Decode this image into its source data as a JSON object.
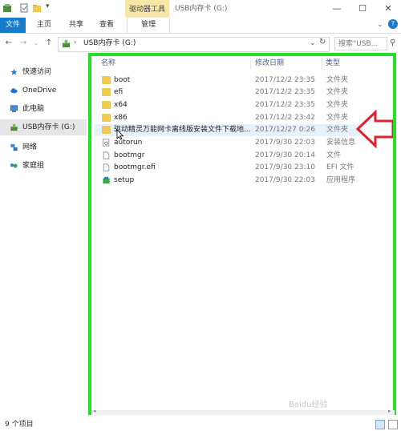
{
  "window": {
    "title": "USB内存卡 (G:)",
    "context_tab": "驱动器工具",
    "controls": {
      "minimize": "—",
      "maximize": "☐",
      "close": "✕"
    }
  },
  "ribbon": {
    "tabs": [
      "文件",
      "主页",
      "共享",
      "查看"
    ],
    "manage_tab": "管理"
  },
  "address": {
    "path": "USB内存卡 (G:)",
    "search_placeholder": "搜索\"USB...",
    "back": "←",
    "forward": "→",
    "up": "↑",
    "dropdown": "⌄",
    "refresh": "↻"
  },
  "nav_pane": {
    "items": [
      {
        "label": "快速访问",
        "icon": "star-icon"
      },
      {
        "label": "OneDrive",
        "icon": "cloud-icon"
      },
      {
        "label": "此电脑",
        "icon": "computer-icon"
      },
      {
        "label": "USB内存卡 (G:)",
        "icon": "usb-drive-icon"
      },
      {
        "label": "网络",
        "icon": "network-icon"
      },
      {
        "label": "家庭组",
        "icon": "homegroup-icon"
      }
    ]
  },
  "columns": {
    "name": "名称",
    "date": "修改日期",
    "type": "类型"
  },
  "files": [
    {
      "name": "boot",
      "date": "2017/12/2 23:35",
      "type": "文件夹",
      "icon": "folder-icon"
    },
    {
      "name": "efi",
      "date": "2017/12/2 23:35",
      "type": "文件夹",
      "icon": "folder-icon"
    },
    {
      "name": "x64",
      "date": "2017/12/2 23:35",
      "type": "文件夹",
      "icon": "folder-icon"
    },
    {
      "name": "x86",
      "date": "2017/12/2 23:42",
      "type": "文件夹",
      "icon": "folder-icon"
    },
    {
      "name": "驱动精灵万能网卡离线版安装文件下载地...",
      "date": "2017/12/27 0:26",
      "type": "文件夹",
      "icon": "folder-icon"
    },
    {
      "name": "autorun",
      "date": "2017/9/30 22:03",
      "type": "安装信息",
      "icon": "settings-file-icon"
    },
    {
      "name": "bootmgr",
      "date": "2017/9/30 20:14",
      "type": "文件",
      "icon": "file-icon"
    },
    {
      "name": "bootmgr.efi",
      "date": "2017/9/30 23:10",
      "type": "EFI 文件",
      "icon": "file-icon"
    },
    {
      "name": "setup",
      "date": "2017/9/30 22:03",
      "type": "应用程序",
      "icon": "setup-app-icon"
    }
  ],
  "status": {
    "count": "9 个项目"
  },
  "watermark": "Baidu经验",
  "colors": {
    "highlight_frame": "#22e022",
    "arrow": "#e0202a",
    "file_tab": "#1979ca",
    "context_tab": "#f6e7a7"
  }
}
